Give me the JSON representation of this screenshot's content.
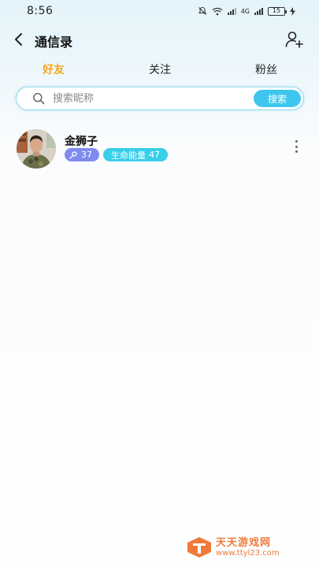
{
  "status_bar": {
    "time": "8:56",
    "battery": "15",
    "network": "4G"
  },
  "header": {
    "title": "通信录"
  },
  "tabs": [
    {
      "label": "好友",
      "active": true
    },
    {
      "label": "关注",
      "active": false
    },
    {
      "label": "粉丝",
      "active": false
    }
  ],
  "search": {
    "placeholder": "搜索昵称",
    "value": "",
    "button_label": "搜索"
  },
  "friends": [
    {
      "name": "金狮子",
      "level": "37",
      "energy_label": "生命能量",
      "energy_value": "47"
    }
  ],
  "colors": {
    "accent_tab": "#f5a623",
    "search_button": "#3ec6ee",
    "level_badge": "#7f8bf0",
    "energy_badge": "#39cfe8"
  },
  "watermark": {
    "main": "天天游戏网",
    "sub": "www.ttyl23.com"
  }
}
